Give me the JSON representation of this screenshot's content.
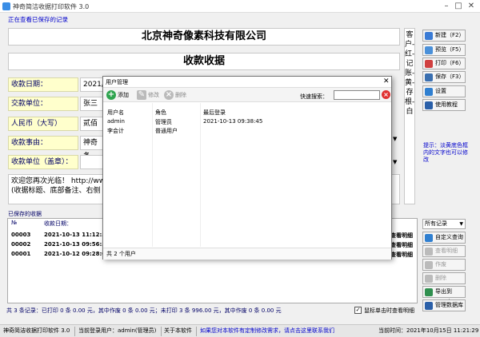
{
  "window": {
    "title": "神奇简洁收据打印软件 3.0"
  },
  "status_view": "正在查看已保存的记录",
  "company": "北京神奇像素科技有限公司",
  "doc_title": "收款收据",
  "fields": [
    {
      "label": "收款日期：",
      "value": "2021/"
    },
    {
      "label": "交款单位：",
      "value": "张三"
    },
    {
      "label": "人民币（大写）",
      "value": "贰佰"
    },
    {
      "label": "收款事由：",
      "value": "神奇条"
    },
    {
      "label": "收款单位（盖章）：",
      "value": ""
    }
  ],
  "notes": [
    "欢迎您再次光临！ http://ww",
    "(收据标题、底部备注、右侧"
  ],
  "side_copy": "客户-红-记账-黄-存根-白",
  "right_buttons": [
    {
      "label": "新建（F2）",
      "color": "#3a7bd5",
      "disabled": false
    },
    {
      "label": "预览（F5）",
      "color": "#4a90d9",
      "disabled": false
    },
    {
      "label": "打印（F6）",
      "color": "#d04040",
      "disabled": false
    },
    {
      "label": "保存（F3）",
      "color": "#3a6fb0",
      "disabled": false
    },
    {
      "label": "设置",
      "color": "#2f7fd0",
      "disabled": false
    },
    {
      "label": "使用教程",
      "color": "#2a5fa8",
      "disabled": false
    }
  ],
  "hint": "提示：淡黄底色框内的文字也可以修改",
  "filter_select": "所有记录",
  "right_buttons_2": [
    {
      "label": "自定义查询",
      "color": "#2f7fd0",
      "disabled": false
    },
    {
      "label": "查看明细",
      "color": "#aaaaaa",
      "disabled": true
    },
    {
      "label": "作废",
      "color": "#aaaaaa",
      "disabled": true
    },
    {
      "label": "删除",
      "color": "#aaaaaa",
      "disabled": true
    },
    {
      "label": "导出到Excel",
      "color": "#2f8f4f",
      "disabled": false
    },
    {
      "label": "管理数据库",
      "color": "#2a5fa8",
      "disabled": false
    }
  ],
  "saved": {
    "label": "已保存的收据",
    "headers": [
      "№",
      "收款日期："
    ],
    "rows": [
      {
        "no": "00003",
        "date": "2021-10-13 11:12:3"
      },
      {
        "no": "00002",
        "date": "2021-10-13 09:56:3"
      },
      {
        "no": "00001",
        "date": "2021-10-12 09:28:0"
      }
    ],
    "tail": [
      "查看明细",
      "查看明细",
      "查看明细"
    ]
  },
  "summary": "共 3 条记录：已打印 0 条 0.00 元，其中作废 0 条 0.00 元；未打印 3 条 996.00 元，其中作废 0 条 0.00 元",
  "checkbox_label": "鼠标单击时查看明细",
  "statusbar": {
    "app": "神奇简洁收据打印软件 3.0",
    "user": "当前登录用户：admin(管理员)",
    "about": "关于本软件",
    "custom": "如果您对本软件有定制修改需求，请点击这里联系我们",
    "time": "当前时间：2021年10月15日 11:21:29"
  },
  "modal": {
    "title": "用户管理",
    "toolbar": {
      "add": "添加",
      "edit": "修改",
      "delete": "删除"
    },
    "search_label": "快速搜索：",
    "search_value": "",
    "headers": [
      "用户名",
      "角色",
      "最后登录"
    ],
    "rows": [
      {
        "name": "admin",
        "role": "管理员",
        "last": "2021-10-13 09:38:45"
      },
      {
        "name": "李会计",
        "role": "普通用户",
        "last": ""
      }
    ],
    "footer": "共 2 个用户"
  }
}
